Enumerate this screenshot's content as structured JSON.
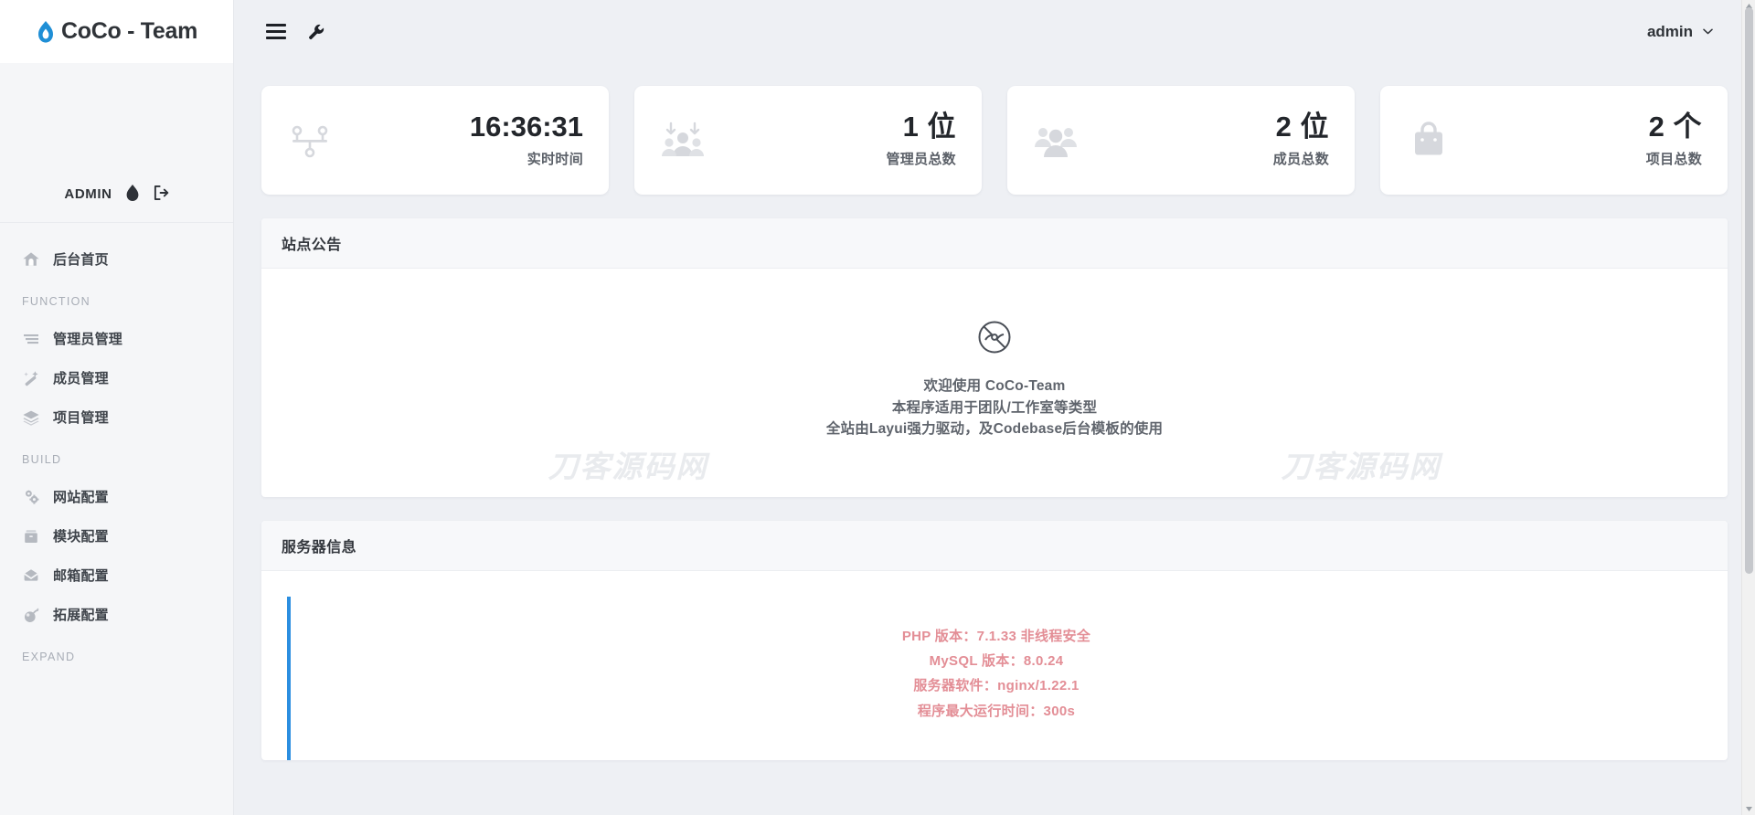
{
  "sidebar": {
    "logo_text": "CoCo - Team",
    "profile_name": "ADMIN",
    "home_item": {
      "label": "后台首页",
      "icon": "home-icon"
    },
    "groups": [
      {
        "label": "FUNCTION",
        "items": [
          {
            "label": "管理员管理",
            "icon": "list-icon"
          },
          {
            "label": "成员管理",
            "icon": "magic-wand-icon"
          },
          {
            "label": "项目管理",
            "icon": "layers-icon"
          }
        ]
      },
      {
        "label": "BUILD",
        "items": [
          {
            "label": "网站配置",
            "icon": "gears-icon"
          },
          {
            "label": "模块配置",
            "icon": "archive-icon"
          },
          {
            "label": "邮箱配置",
            "icon": "envelope-icon"
          },
          {
            "label": "拓展配置",
            "icon": "bomb-icon"
          }
        ]
      },
      {
        "label": "EXPAND",
        "items": []
      }
    ]
  },
  "topbar": {
    "menu_icon": "hamburger-icon",
    "tools_icon": "wrench-icon",
    "user_name": "admin",
    "caret_icon": "chevron-down-icon"
  },
  "cards": [
    {
      "icon": "balance-scale-icon",
      "value": "16:36:31",
      "label": "实时时间",
      "is_time": true
    },
    {
      "icon": "user-download-icon",
      "value": "1 位",
      "label": "管理员总数",
      "is_time": false
    },
    {
      "icon": "users-icon",
      "value": "2 位",
      "label": "成员总数",
      "is_time": false
    },
    {
      "icon": "briefcase-icon",
      "value": "2 个",
      "label": "项目总数",
      "is_time": false
    }
  ],
  "notice_panel": {
    "title": "站点公告",
    "icon": "no-disc-icon",
    "lines": [
      "欢迎使用 CoCo-Team",
      "本程序适用于团队/工作室等类型",
      "全站由Layui强力驱动，及Codebase后台模板的使用"
    ],
    "watermark_left": "刀客源码网",
    "watermark_right": "刀客源码网"
  },
  "server_panel": {
    "title": "服务器信息",
    "accent_color": "#2b8ee0",
    "text_color": "#e38e96",
    "lines": [
      "PHP 版本：7.1.33 非线程安全",
      "MySQL 版本：8.0.24",
      "服务器软件：nginx/1.22.1",
      "程序最大运行时间：300s"
    ]
  }
}
